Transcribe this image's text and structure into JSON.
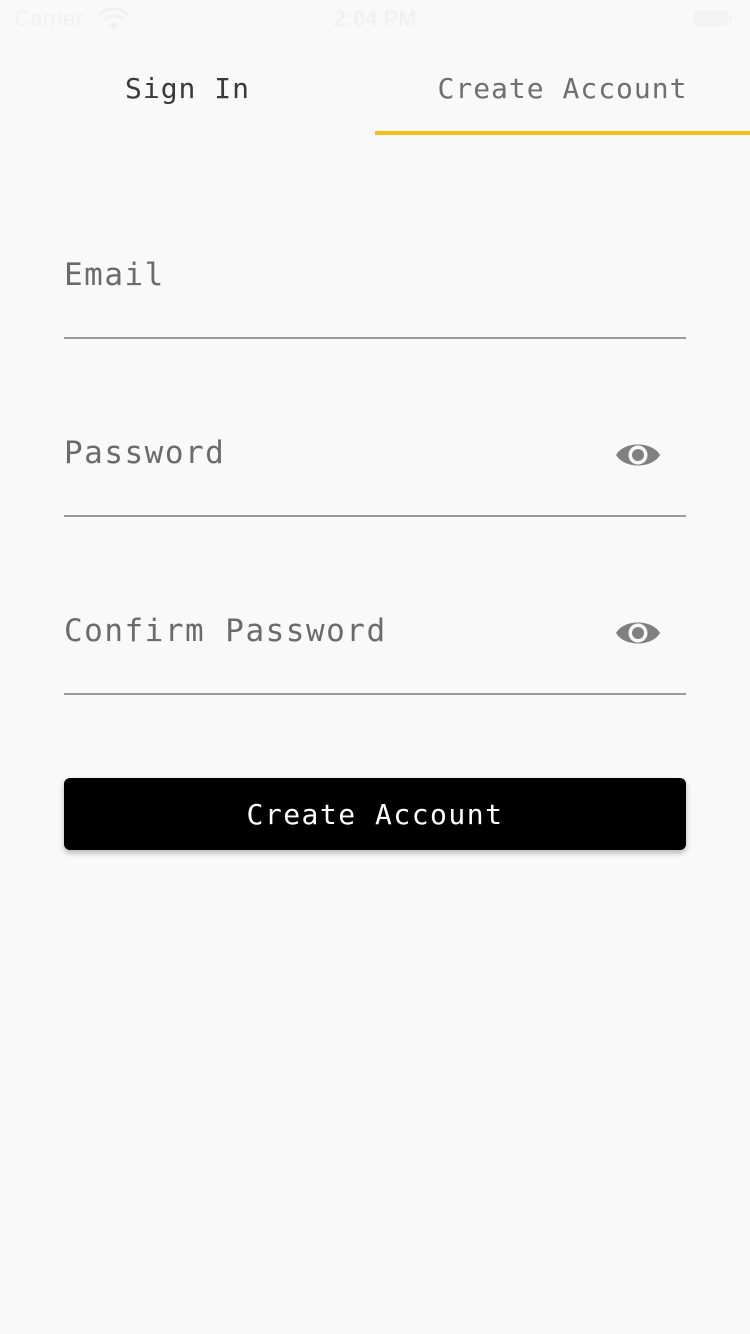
{
  "status_bar": {
    "carrier": "Carrier",
    "time": "2:04 PM"
  },
  "tabs": [
    {
      "label": "Sign In",
      "selected": false
    },
    {
      "label": "Create Account",
      "selected": true
    }
  ],
  "form": {
    "email_label": "Email",
    "password_label": "Password",
    "confirm_password_label": "Confirm Password",
    "submit_label": "Create Account"
  },
  "icons": {
    "wifi": "wifi-icon",
    "battery": "battery-icon",
    "visibility": "eye-icon"
  },
  "colors": {
    "background": "#f9f9f9",
    "tab_indicator": "#f5c01a",
    "button_bg": "#000000",
    "button_text": "#ffffff",
    "field_underline": "#9a9a9a",
    "icon_gray": "#808080"
  }
}
